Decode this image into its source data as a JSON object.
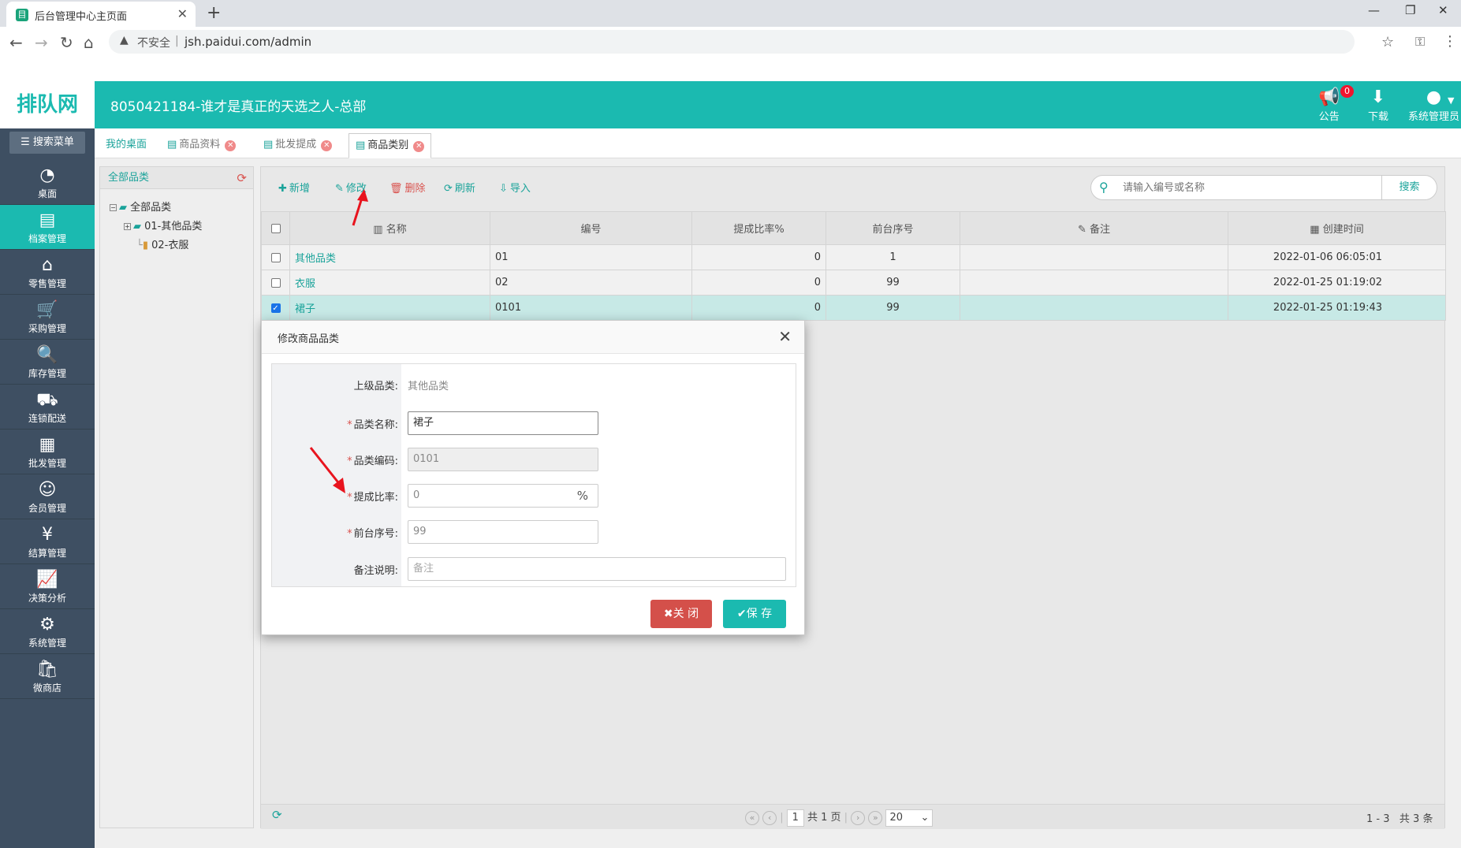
{
  "browser": {
    "tab_title": "后台管理中心主页面",
    "url": "jsh.paidui.com/admin",
    "insecure_label": "不安全"
  },
  "header": {
    "logo": "排队网",
    "company": "8050421184-谁才是真正的天选之人-总部",
    "notice_label": "公告",
    "notice_count": "0",
    "download_label": "下载",
    "user_label": "系统管理员"
  },
  "sidebar": {
    "search_label": "搜索菜单",
    "items": [
      {
        "label": "桌面",
        "icon": "dashboard-icon"
      },
      {
        "label": "档案管理",
        "icon": "archive-icon"
      },
      {
        "label": "零售管理",
        "icon": "store-icon"
      },
      {
        "label": "采购管理",
        "icon": "cart-icon"
      },
      {
        "label": "库存管理",
        "icon": "inventory-icon"
      },
      {
        "label": "连锁配送",
        "icon": "truck-icon"
      },
      {
        "label": "批发管理",
        "icon": "wholesale-icon"
      },
      {
        "label": "会员管理",
        "icon": "member-icon"
      },
      {
        "label": "结算管理",
        "icon": "settle-icon"
      },
      {
        "label": "决策分析",
        "icon": "chart-icon"
      },
      {
        "label": "系统管理",
        "icon": "gear-icon"
      },
      {
        "label": "微商店",
        "icon": "shop-icon"
      }
    ]
  },
  "tabs": [
    {
      "label": "我的桌面"
    },
    {
      "label": "商品资料"
    },
    {
      "label": "批发提成"
    },
    {
      "label": "商品类别"
    }
  ],
  "tree": {
    "title": "全部品类",
    "root": "全部品类",
    "node1": "01-其他品类",
    "node2": "02-衣服"
  },
  "toolbar": {
    "add": "新增",
    "edit": "修改",
    "delete": "删除",
    "refresh": "刷新",
    "import": "导入",
    "search_placeholder": "请输入编号或名称",
    "search_btn": "搜索"
  },
  "table": {
    "columns": [
      "名称",
      "编号",
      "提成比率%",
      "前台序号",
      "备注",
      "创建时间"
    ],
    "rows": [
      {
        "name": "其他品类",
        "code": "01",
        "rate": "0",
        "seq": "1",
        "remark": "",
        "created": "2022-01-06 06:05:01"
      },
      {
        "name": "衣服",
        "code": "02",
        "rate": "0",
        "seq": "99",
        "remark": "",
        "created": "2022-01-25 01:19:02"
      },
      {
        "name": "裙子",
        "code": "0101",
        "rate": "0",
        "seq": "99",
        "remark": "",
        "created": "2022-01-25 01:19:43"
      }
    ]
  },
  "pager": {
    "page": "1",
    "total_pages": "共 1 页",
    "page_size": "20",
    "range": "1 - 3",
    "total": "共 3 条"
  },
  "modal": {
    "title": "修改商品品类",
    "parent_label": "上级品类:",
    "parent_value": "其他品类",
    "name_label": "品类名称:",
    "name_value": "裙子",
    "code_label": "品类编码:",
    "code_value": "0101",
    "rate_label": "提成比率:",
    "rate_value": "0",
    "rate_suffix": "%",
    "seq_label": "前台序号:",
    "seq_value": "99",
    "remark_label": "备注说明:",
    "remark_placeholder": "备注",
    "close_btn": "关 闭",
    "save_btn": "保 存"
  },
  "colors": {
    "accent": "#1bbab0",
    "sidebar": "#3e4f62",
    "danger": "#d4504a"
  }
}
